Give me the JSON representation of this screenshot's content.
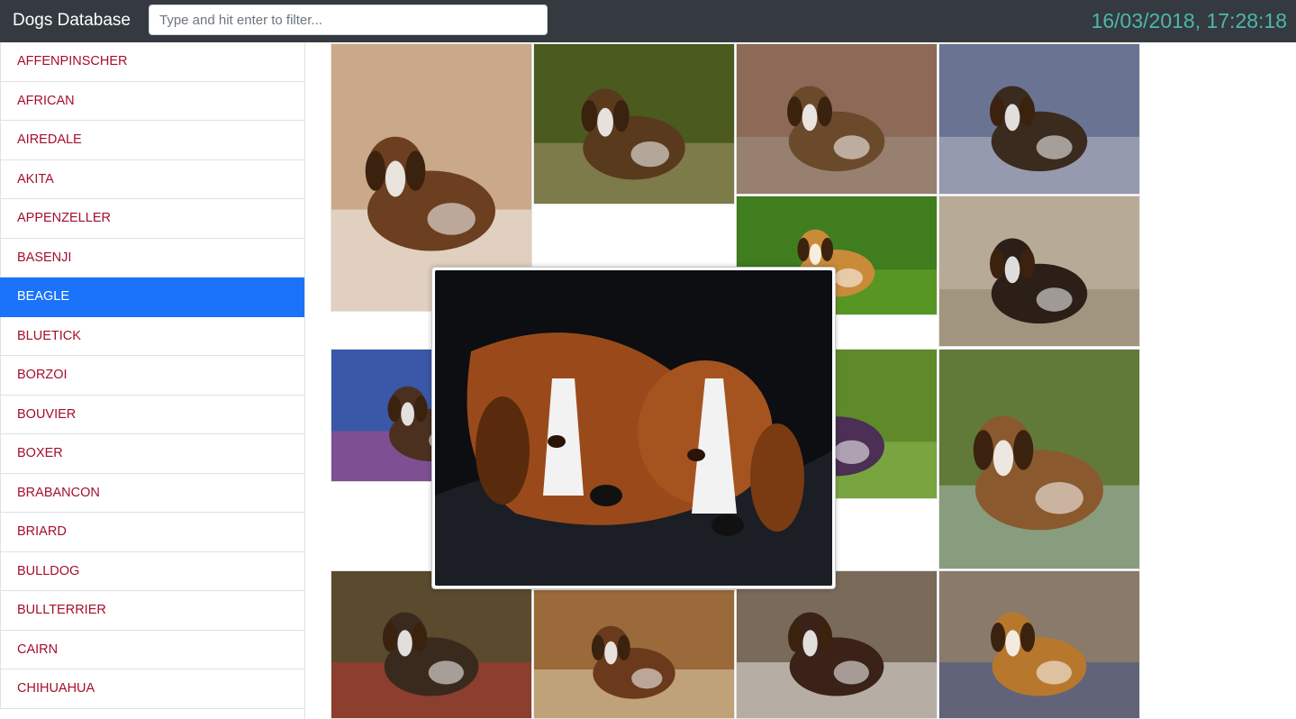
{
  "app": {
    "title": "Dogs Database"
  },
  "search": {
    "placeholder": "Type and hit enter to filter...",
    "value": ""
  },
  "clock": {
    "text": "16/03/2018, 17:28:18"
  },
  "colors": {
    "navbar": "#343a40",
    "clock": "#4db6ac",
    "breed_link": "#a50e2d",
    "active": "#1a73f8"
  },
  "sidebar": {
    "selected": "BEAGLE",
    "breeds": [
      "AFFENPINSCHER",
      "AFRICAN",
      "AIREDALE",
      "AKITA",
      "APPENZELLER",
      "BASENJI",
      "BEAGLE",
      "BLUETICK",
      "BORZOI",
      "BOUVIER",
      "BOXER",
      "BRABANCON",
      "BRIARD",
      "BULLDOG",
      "BULLTERRIER",
      "CAIRN",
      "CHIHUAHUA"
    ]
  },
  "gallery": {
    "photos": [
      {
        "name": "beagle-puppy-held-photo",
        "bg": "#c9a98a",
        "accent": "#ffffff",
        "dog": "#6b3f1f"
      },
      {
        "name": "beagle-on-gravel-photo",
        "bg": "#4b5a1e",
        "accent": "#b9a37e",
        "dog": "#5a3a1c"
      },
      {
        "name": "beagle-with-man-photo",
        "bg": "#8d6a58",
        "accent": "#a39b8d",
        "dog": "#6b4a2c"
      },
      {
        "name": "beagle-puppy-blanket-photo",
        "bg": "#6b7393",
        "accent": "#c9c9d3",
        "dog": "#3b2a1e"
      },
      {
        "name": "two-beagles-playing-photo",
        "bg": "#3f7d1e",
        "accent": "#78b62a",
        "dog": "#c98a3a"
      },
      {
        "name": "beagle-indoor-floor-photo",
        "bg": "#b7ab98",
        "accent": "#8a7a62",
        "dog": "#2b1f18"
      },
      {
        "name": "beagle-puppy-toy-photo",
        "bg": "#3a57a8",
        "accent": "#d24a7a",
        "dog": "#4b3020"
      },
      {
        "name": "beagle-on-grass-photo",
        "bg": "#5e8a2a",
        "accent": "#9cc65b",
        "dog": "#4b2f55"
      },
      {
        "name": "beagle-portrait-photo",
        "bg": "#617a3a",
        "accent": "#b9c7d0",
        "dog": "#8a5a2e"
      },
      {
        "name": "beagles-on-leash-photo",
        "bg": "#5a4a2e",
        "accent": "#c9342e",
        "dog": "#3a2a1e"
      },
      {
        "name": "beagle-with-plate-photo",
        "bg": "#9a6a3a",
        "accent": "#f0e6c8",
        "dog": "#6b3a1c"
      },
      {
        "name": "beagle-puppy-closeup-photo",
        "bg": "#7a6a5a",
        "accent": "#ffffff",
        "dog": "#3a2218"
      },
      {
        "name": "beagle-on-knit-blanket-photo",
        "bg": "#8a7a6a",
        "accent": "#2e4a8a",
        "dog": "#b7782e"
      }
    ],
    "modal_photo": {
      "name": "two-beagles-on-sofa-photo",
      "bg": "#0c0e12",
      "accent": "#1b1e24",
      "dog": "#9a4a1a"
    }
  }
}
